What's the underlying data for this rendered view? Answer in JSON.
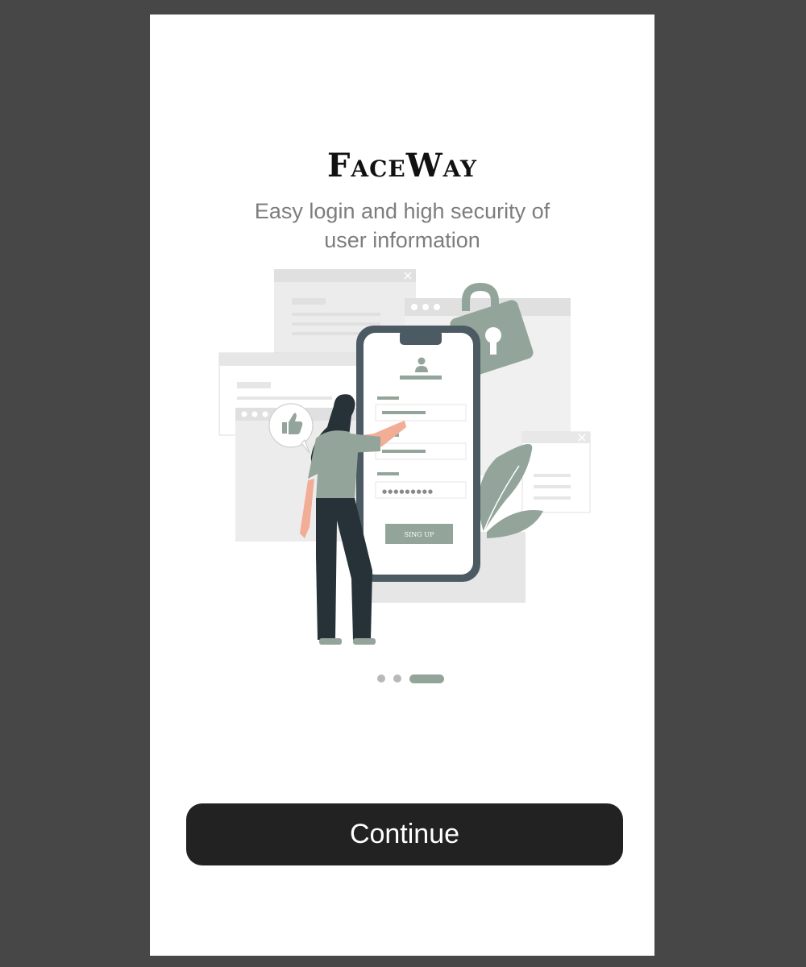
{
  "app": {
    "title": "FaceWay",
    "subtitle": "Easy login and high security of user information"
  },
  "illustration": {
    "phone_button_label": "SING UP",
    "password_mask": "●●●●●●●●●"
  },
  "pager": {
    "total": 3,
    "active_index": 2
  },
  "actions": {
    "continue_label": "Continue"
  },
  "colors": {
    "background": "#474747",
    "screen": "#ffffff",
    "accent": "#93a59a",
    "button": "#222222",
    "phone_frame": "#4b5a63",
    "figure_dark": "#263238"
  }
}
